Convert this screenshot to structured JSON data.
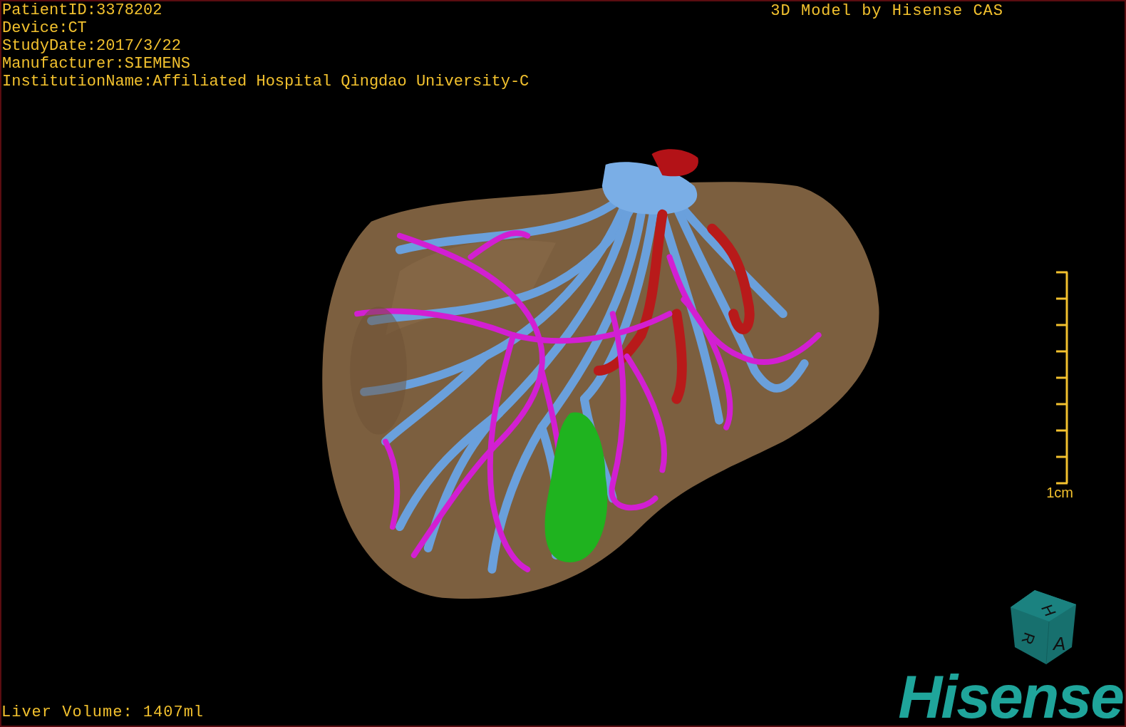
{
  "study_info": [
    "PatientID:3378202",
    "Device:CT",
    "StudyDate:2017/3/22",
    "Manufacturer:SIEMENS",
    "InstitutionName:Affiliated Hospital Qingdao University-C"
  ],
  "model_credit": "3D Model by Hisense CAS",
  "scale_bar": {
    "label": "1cm"
  },
  "liver_volume": "Liver Volume: 1407ml",
  "orientation_cube": {
    "faces": [
      "H",
      "R",
      "A"
    ]
  },
  "logo": "Hisense"
}
